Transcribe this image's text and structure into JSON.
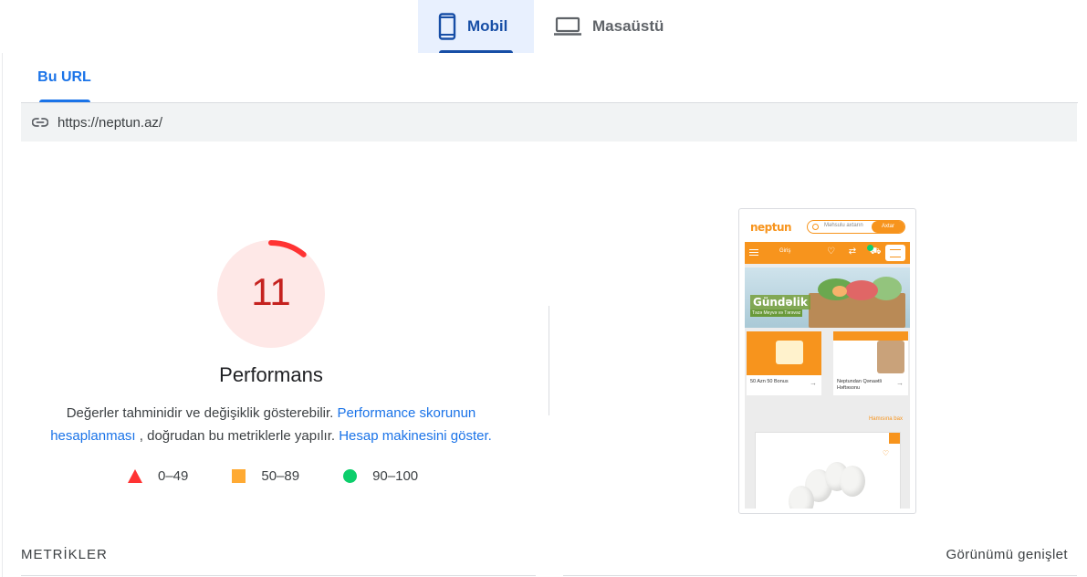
{
  "device_tabs": [
    {
      "label": "Mobil",
      "icon": "phone-icon",
      "active": true
    },
    {
      "label": "Masaüstü",
      "icon": "laptop-icon",
      "active": false
    }
  ],
  "url_tab": {
    "label": "Bu URL"
  },
  "url": {
    "icon": "link-icon",
    "value": "https://neptun.az/"
  },
  "performance": {
    "score": "11",
    "score_fraction": 0.11,
    "title": "Performans",
    "status_color": "#c5221f",
    "ring_color": "#ff3333",
    "fill_color": "#fee8e7",
    "description": {
      "text1": "Değerler tahminidir ve değişiklik gösterebilir.",
      "link1": "Performance skorunun hesaplanması",
      "text2": ", doğrudan bu metriklerle yapılır.",
      "link2": "Hesap makinesini göster."
    }
  },
  "legend": [
    {
      "shape": "triangle",
      "range": "0–49",
      "color": "#ff3333"
    },
    {
      "shape": "square",
      "range": "50–89",
      "color": "#ffaa33"
    },
    {
      "shape": "circle",
      "range": "90–100",
      "color": "#0cce6b"
    }
  ],
  "screenshot": {
    "logo": "neptun",
    "search_placeholder": "Məhsulu axtarın",
    "search_button": "Axtar",
    "nav_login": "Giriş",
    "banner_title": "Gündəlik",
    "banner_sub": "Təzə Meyvə və Tərəvəz",
    "card1_text": "50 Azn 50 Bonus",
    "card2_text": "Neptundan Qənaətli Həftəsonu",
    "section_link": "Hamısına bax",
    "accent_color": "#f7941d"
  },
  "metrics": {
    "label": "METRİKLER",
    "expand_label": "Görünümü genişlet"
  }
}
